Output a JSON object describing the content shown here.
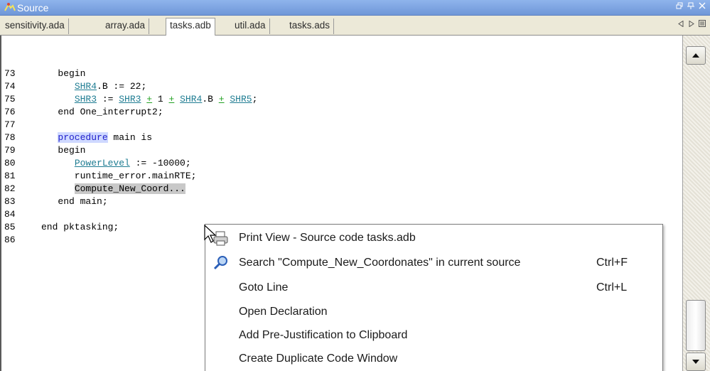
{
  "window": {
    "title": "Source",
    "icon": "source-window-icon",
    "controls": [
      "restore-icon",
      "pin-icon",
      "close-icon"
    ]
  },
  "tabs": [
    {
      "label": "sensitivity.ada",
      "active": false
    },
    {
      "label": "array.ada",
      "active": false
    },
    {
      "label": "tasks.adb",
      "active": true
    },
    {
      "label": "util.ada",
      "active": false
    },
    {
      "label": "tasks.ads",
      "active": false
    }
  ],
  "tab_nav": [
    "scroll-left-icon",
    "scroll-right-icon",
    "tab-list-icon"
  ],
  "code": {
    "lines": {
      "l73": {
        "num": "73",
        "text": "   begin"
      },
      "l74": {
        "num": "74",
        "indent": "      ",
        "var": "SHR4",
        "rest": ".B := 22;"
      },
      "l75": {
        "num": "75",
        "indent": "      ",
        "a": "SHR3",
        "assign": " := ",
        "b": "SHR3",
        "plus": "+",
        "one": " 1 ",
        "c": "SHR4",
        "cb": ".B ",
        "d": "SHR5",
        "end": ";"
      },
      "l76": {
        "num": "76",
        "text": "   end One_interrupt2;"
      },
      "l77": {
        "num": "77",
        "text": ""
      },
      "l78": {
        "num": "78",
        "indent": "   ",
        "kw": "procedure",
        "rest": " main is"
      },
      "l79": {
        "num": "79",
        "text": "   begin"
      },
      "l80": {
        "num": "80",
        "indent": "      ",
        "var": "PowerLevel",
        "rest": " := -10000;"
      },
      "l81": {
        "num": "81",
        "text": "      runtime_error.mainRTE;"
      },
      "l82": {
        "num": "82",
        "indent": "      ",
        "sel": "Compute_New_Coord",
        "rest": "..."
      },
      "l83": {
        "num": "83",
        "text": "   end main;"
      },
      "l84": {
        "num": "84",
        "text": ""
      },
      "l85": {
        "num": "85",
        "text": "end pktasking;"
      },
      "l86": {
        "num": "86",
        "text": ""
      }
    }
  },
  "context_menu": {
    "items": [
      {
        "label": "Print View - Source code tasks.adb",
        "shortcut": "",
        "icon": "print-view-icon"
      },
      {
        "label": "Search \"Compute_New_Coordonates\" in current source",
        "shortcut": "Ctrl+F",
        "icon": "search-icon"
      },
      {
        "label": "Goto Line",
        "shortcut": "Ctrl+L",
        "icon": ""
      },
      {
        "label": "Open Declaration",
        "shortcut": "",
        "icon": ""
      },
      {
        "label": "Add Pre-Justification to Clipboard",
        "shortcut": "",
        "icon": ""
      },
      {
        "label": "Create Duplicate Code Window",
        "shortcut": "",
        "icon": ""
      }
    ]
  },
  "colors": {
    "link": "#1e7c92",
    "operator": "#22a122",
    "keyword_highlight": "#cfd9ff",
    "selection": "#c8c8c8",
    "titlebar": "#7ba2e0"
  }
}
